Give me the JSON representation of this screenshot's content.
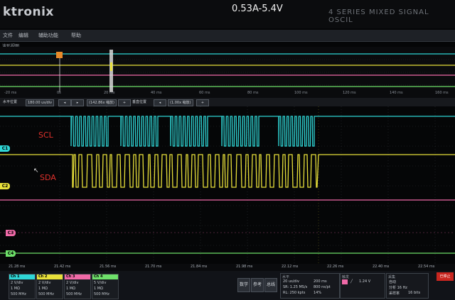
{
  "bezel": {
    "brand": "ktronix",
    "series": "4 SERIES   MIXED SIGNAL OSCIL"
  },
  "banner": "0.53A-5.4V",
  "menu": [
    "文件",
    "编辑",
    "辅助功能",
    "帮助"
  ],
  "overview": {
    "label": "波形视图",
    "ticks": [
      "-20 ms",
      "0s",
      "20 ms",
      "40 ms",
      "60 ms",
      "80 ms",
      "100 ms",
      "120 ms",
      "140 ms",
      "160 ms"
    ]
  },
  "controls": {
    "rate_label": "水平位置",
    "rate_value": "180.00 us/div",
    "zoom_value": "(142.86x 缩放)",
    "zoom2_label": "垂直位置",
    "zoom2_value": "(1.00x 缩放)"
  },
  "signals": {
    "scl_label": "SCL",
    "sda_label": "SDA"
  },
  "markers": [
    "C1",
    "C2",
    "C3",
    "C4"
  ],
  "time_ticks": [
    "21.28 ms",
    "21.42 ms",
    "21.56 ms",
    "21.70 ms",
    "21.84 ms",
    "21.98 ms",
    "22.12 ms",
    "22.26 ms",
    "22.40 ms",
    "22.54 ms"
  ],
  "channels": [
    {
      "name": "Ch 1",
      "scale": "2 V/div",
      "imp": "1 MΩ",
      "bw": "500 MHz",
      "color": "#2fd6d6"
    },
    {
      "name": "Ch 2",
      "scale": "2 V/div",
      "imp": "1 MΩ",
      "bw": "500 MHz",
      "color": "#e8e03a"
    },
    {
      "name": "Ch 3",
      "scale": "2 V/div",
      "imp": "1 MΩ",
      "bw": "500 MHz",
      "color": "#f06aa8"
    },
    {
      "name": "Ch 4",
      "scale": "5 V/div",
      "imp": "1 MΩ",
      "bw": "500 MHz",
      "color": "#6ee06a"
    }
  ],
  "buttons": [
    "数学",
    "参考",
    "总线"
  ],
  "horizontal": {
    "title": "水平",
    "l1": "20 us/div",
    "l2": "SR: 1.25 MS/s",
    "l3": "RL: 250 kpts",
    "r1": "200 ms",
    "r2": "800 ns/pt",
    "r3": "14%"
  },
  "trigger": {
    "title": "触发",
    "level": "1.24 V"
  },
  "acquisition": {
    "title": "采集",
    "mode": "自动",
    "l1": "分析 16 Hz",
    "l2": "采样率",
    "l3": "16 bits"
  },
  "stop_label": "已停止"
}
